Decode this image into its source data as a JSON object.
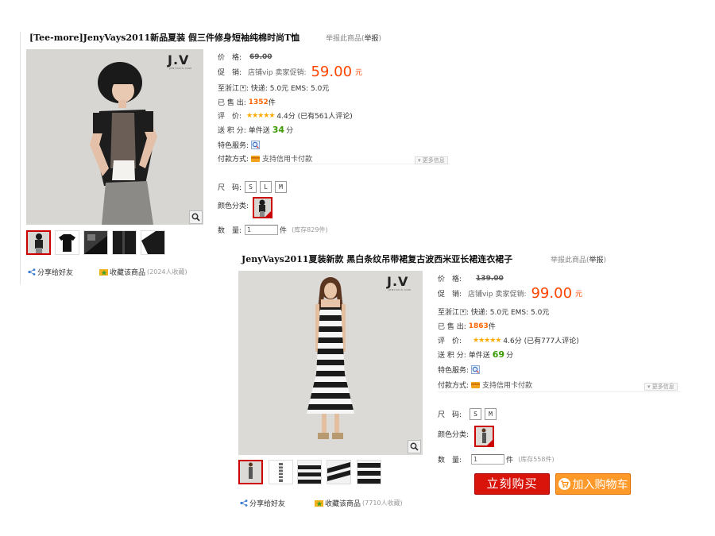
{
  "products": [
    {
      "title": "[Tee-more]JenyVays2011新品夏装 假三件修身短袖纯棉时尚T恤",
      "report_prefix": "举报此商品(",
      "report_link": "举报",
      "report_suffix": ")",
      "brand": "J.V",
      "brand_sub": "JENYVAYS.COM",
      "price_label": "价　格:",
      "price": "69.00",
      "promo_label": "促　销:",
      "promo_tag": "店铺vip  卖家促销:",
      "promo_price": "59.00",
      "currency": "元",
      "ship_label": "至浙江",
      "ship_text": ": 快递: 5.0元  EMS: 5.0元",
      "sold_label": "已 售 出:",
      "sold_count": "1352",
      "sold_unit": "件",
      "rating_label": "评　价:",
      "rating_stars": "★★★★★",
      "rating_text": "4.4分 (已有561人评论)",
      "points_label": "送 积 分:",
      "points_prefix": "单件送",
      "points": "34",
      "points_unit": "分",
      "service_label": "特色服务:",
      "payment_label": "付款方式:",
      "payment_text": "支持信用卡付款",
      "more_info": "▾ 更多信息",
      "size_label": "尺　码:",
      "sizes": [
        "S",
        "L",
        "M"
      ],
      "color_label": "颜色分类:",
      "qty_label": "数　量:",
      "qty_value": "1",
      "qty_unit": "件",
      "stock": "(库存829件)",
      "share": "分享给好友",
      "collect": "收藏该商品",
      "collect_count": "(2024人收藏)"
    },
    {
      "title": "JenyVays2011夏装新款 黑白条纹吊带裙复古波西米亚长裙连衣裙子",
      "report_prefix": "举报此商品(",
      "report_link": "举报",
      "report_suffix": ")",
      "brand": "J.V",
      "brand_sub": "JENYVAYS.COM",
      "price_label": "价　格:",
      "price": "139.00",
      "promo_label": "促　销:",
      "promo_tag": "店铺vip  卖家促销:",
      "promo_price": "99.00",
      "currency": "元",
      "ship_label": "至浙江",
      "ship_text": ": 快递: 5.0元  EMS: 5.0元",
      "sold_label": "已 售 出:",
      "sold_count": "1863",
      "sold_unit": "件",
      "rating_label": "评　价:",
      "rating_stars": "★★★★★",
      "rating_text": "4.6分 (已有777人评论)",
      "points_label": "送 积 分:",
      "points_prefix": "单件送",
      "points": "69",
      "points_unit": "分",
      "service_label": "特色服务:",
      "payment_label": "付款方式:",
      "payment_text": "支持信用卡付款",
      "more_info": "▾ 更多信息",
      "size_label": "尺　码:",
      "sizes": [
        "S",
        "M"
      ],
      "color_label": "颜色分类:",
      "qty_label": "数　量:",
      "qty_value": "1",
      "qty_unit": "件",
      "stock": "(库存558件)",
      "buy_label": "立刻购买",
      "cart_label": "加入购物车",
      "share": "分享给好友",
      "collect": "收藏该商品",
      "collect_count": "(7710人收藏)"
    }
  ],
  "colors": {
    "price_red": "#ff4400",
    "sold_orange": "#ff6600",
    "points_green": "#3a9a00",
    "buy_button": "#d8140b",
    "cart_button": "#ff9a2a"
  }
}
